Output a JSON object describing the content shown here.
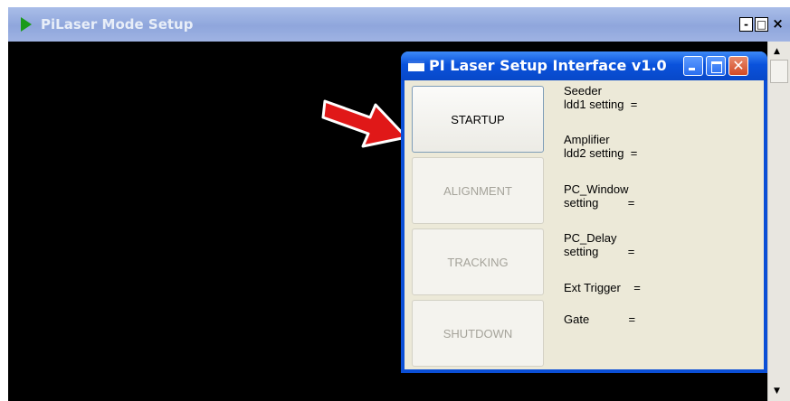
{
  "outer_window": {
    "title": "PiLaser Mode Setup",
    "minimize": "-",
    "maximize": "□",
    "close": "×"
  },
  "dialog": {
    "title": "PI Laser Setup Interface v1.0",
    "buttons": {
      "startup": "STARTUP",
      "alignment": "ALIGNMENT",
      "tracking": "TRACKING",
      "shutdown": "SHUTDOWN"
    },
    "labels": {
      "seeder_line1": "Seeder",
      "seeder_line2": "ldd1 setting  =",
      "amplifier_line1": "Amplifier",
      "amplifier_line2": "ldd2 setting  =",
      "pc_window_line1": "PC_Window",
      "pc_window_line2": "setting         =",
      "pc_delay_line1": "PC_Delay",
      "pc_delay_line2": "setting         =",
      "ext_trigger": "Ext Trigger    =",
      "gate": "Gate            ="
    }
  },
  "colors": {
    "arrow": "#e01818",
    "title_blue": "#0a52dc",
    "dialog_bg": "#ece9d8"
  }
}
